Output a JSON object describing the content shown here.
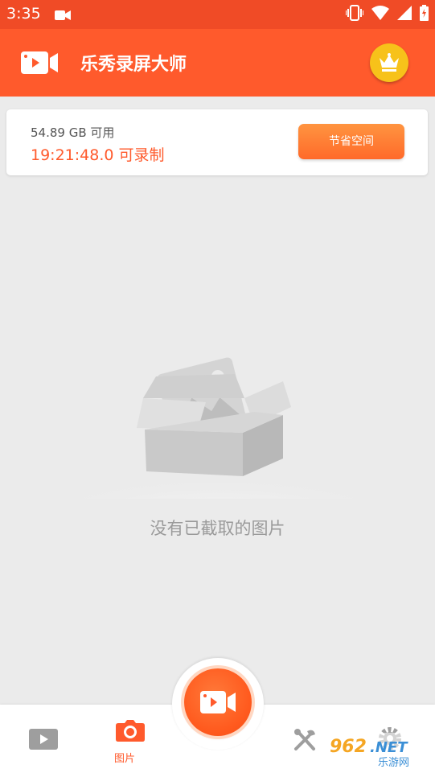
{
  "status_bar": {
    "time": "3:35"
  },
  "app_bar": {
    "title": "乐秀录屏大师"
  },
  "storage": {
    "free_space": "54.89 GB 可用",
    "record_time": "19:21:48.0 可录制",
    "save_space_button": "节省空间"
  },
  "empty_state": {
    "message": "没有已截取的图片"
  },
  "bottom_nav": {
    "items": [
      {
        "icon": "video-list-icon",
        "label": ""
      },
      {
        "icon": "camera-icon",
        "label": "图片",
        "active": true
      },
      {
        "icon": "tools-icon",
        "label": ""
      },
      {
        "icon": "settings-icon",
        "label": ""
      }
    ]
  },
  "watermark": {
    "text": "962.NET",
    "subtext": "乐游网"
  },
  "colors": {
    "status_bar": "#f04b26",
    "app_bar": "#ff5a2c",
    "accent": "#ff5a2c",
    "vip_gold": "#f7c21a",
    "background": "#ebebeb"
  }
}
